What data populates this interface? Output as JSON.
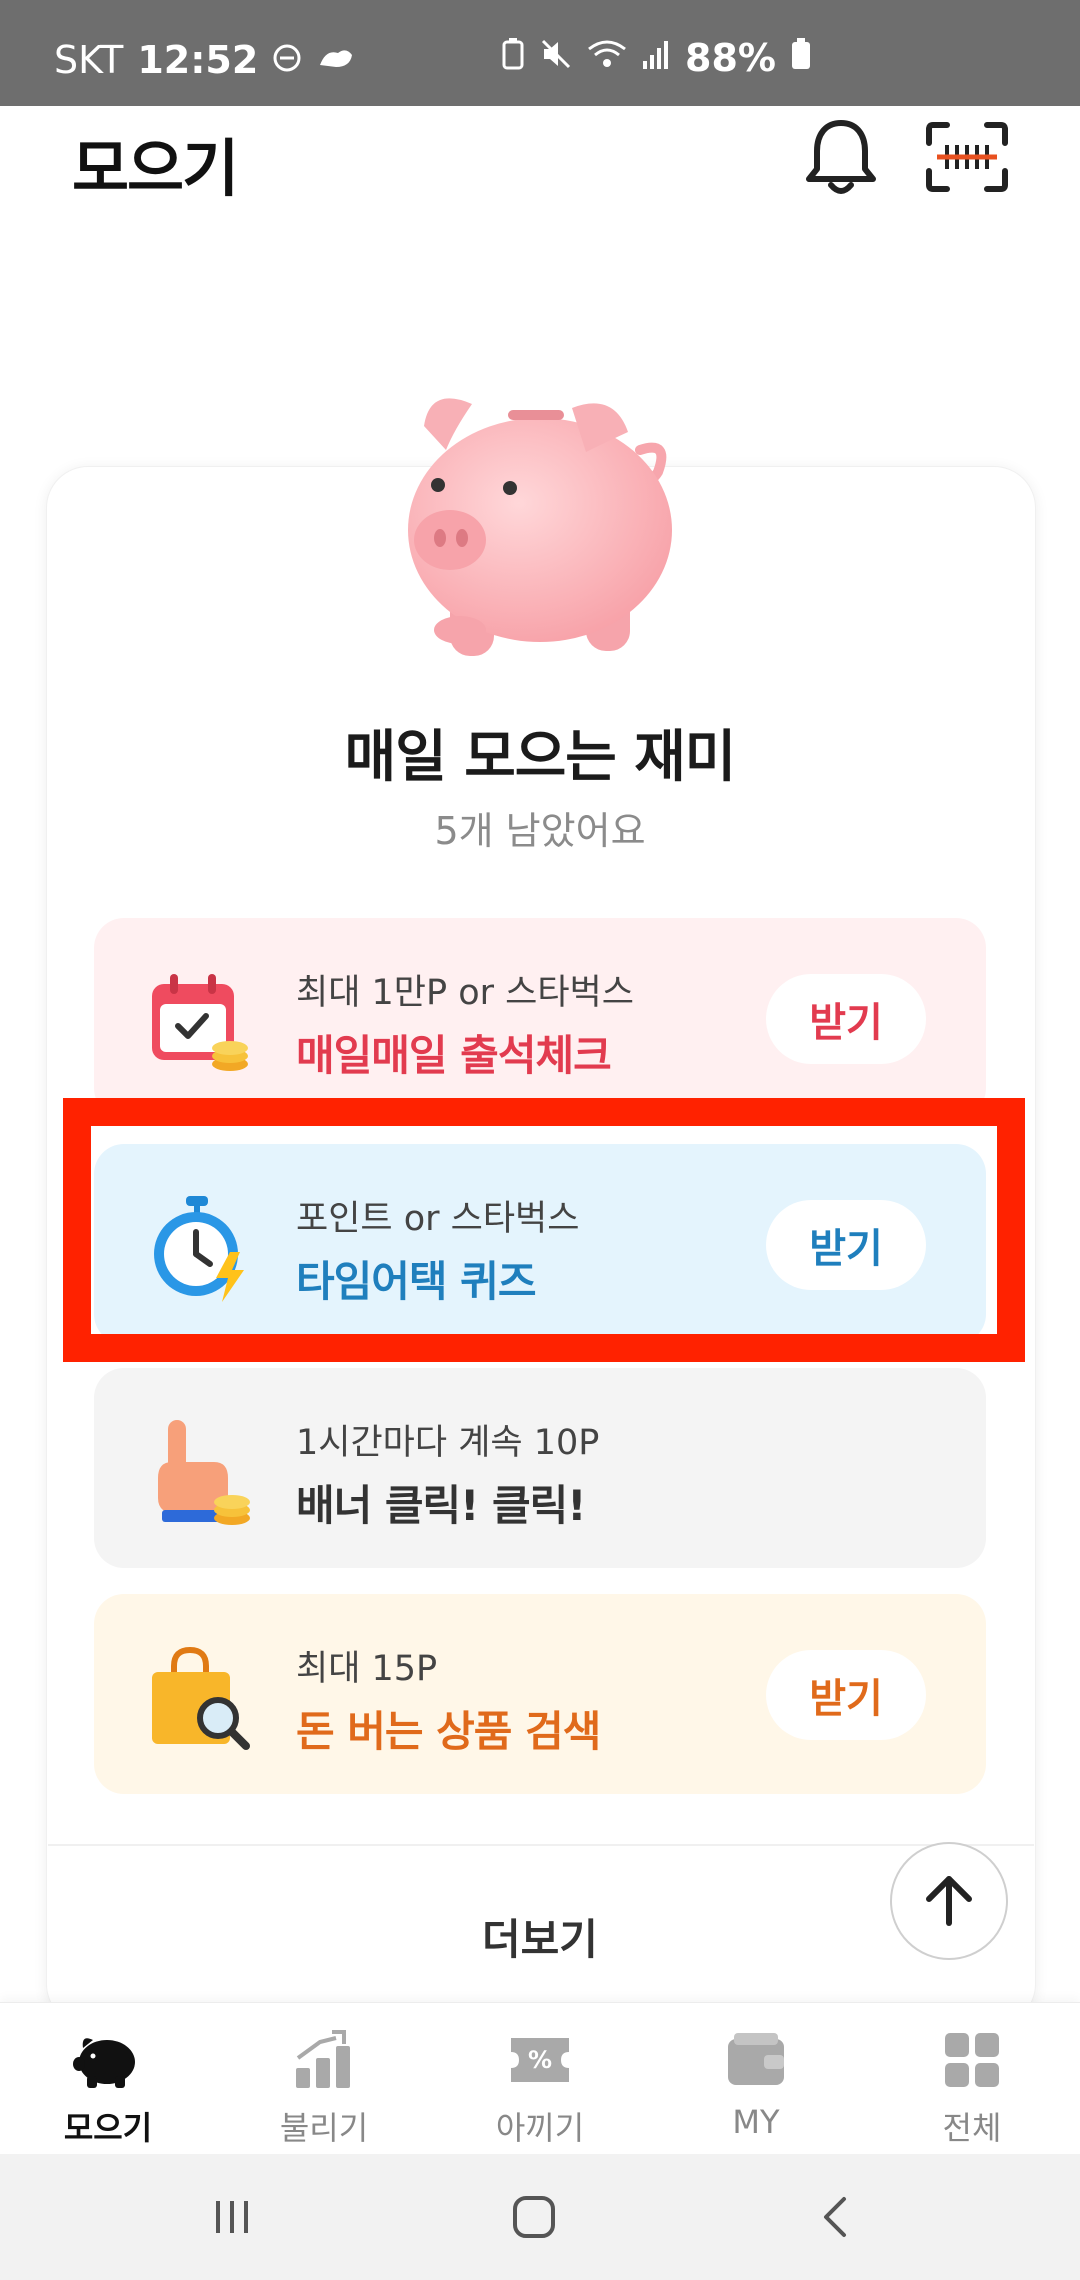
{
  "status_bar": {
    "carrier": "SKT",
    "time": "12:52",
    "battery": "88%"
  },
  "header": {
    "title": "모으기",
    "bell_icon": "bell-icon",
    "scan_icon": "barcode-scan-icon"
  },
  "card": {
    "title": "매일 모으는 재미",
    "subtitle": "5개 남았어요",
    "missions": [
      {
        "label": "최대 1만P or 스타벅스",
        "title": "매일매일 출석체크",
        "button": "받기",
        "icon": "calendar-coin-icon",
        "color": "#e23b4f"
      },
      {
        "label": "포인트 or 스타벅스",
        "title": "타임어택 퀴즈",
        "button": "받기",
        "icon": "stopwatch-icon",
        "color": "#1f7fbd"
      },
      {
        "label": "1시간마다 계속 10P",
        "title": "배너 클릭! 클릭!",
        "button": "",
        "icon": "hand-coin-icon",
        "color": "#333333"
      },
      {
        "label": "최대 15P",
        "title": "돈 버는 상품 검색",
        "button": "받기",
        "icon": "shopping-bag-search-icon",
        "color": "#e06a1b"
      }
    ],
    "more_label": "더보기"
  },
  "bottom_nav": {
    "items": [
      {
        "label": "모으기",
        "icon": "piggy-bank-icon",
        "active": true
      },
      {
        "label": "불리기",
        "icon": "growth-chart-icon",
        "active": false
      },
      {
        "label": "아끼기",
        "icon": "coupon-icon",
        "active": false
      },
      {
        "label": "MY",
        "icon": "wallet-icon",
        "active": false
      },
      {
        "label": "전체",
        "icon": "grid-icon",
        "active": false
      }
    ]
  }
}
